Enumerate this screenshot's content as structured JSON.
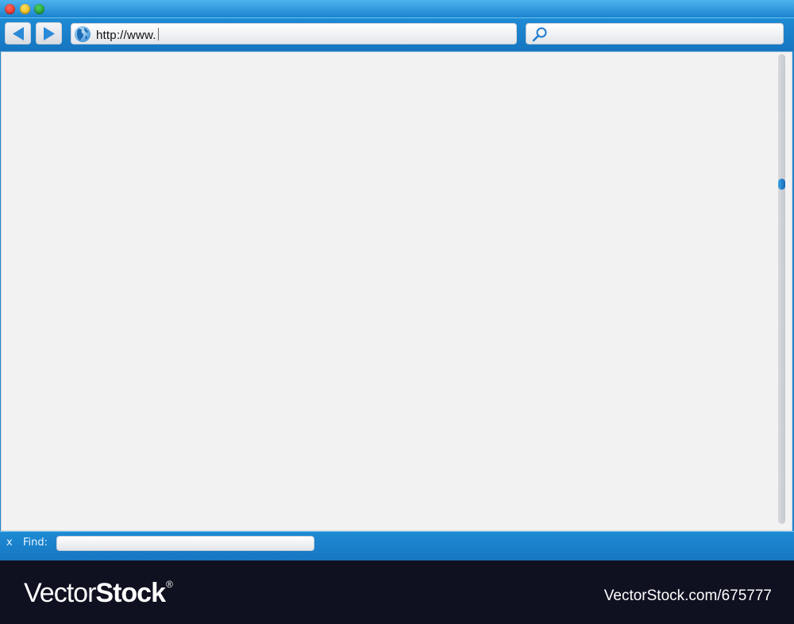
{
  "window": {
    "controls": {
      "close": "close-icon",
      "minimize": "minimize-icon",
      "maximize": "maximize-icon"
    },
    "accent_color": "#1f86cf"
  },
  "toolbar": {
    "back_icon": "back-arrow-icon",
    "forward_icon": "forward-arrow-icon",
    "url": {
      "icon": "globe-icon",
      "value": "http://www."
    },
    "search": {
      "icon": "search-icon",
      "value": ""
    }
  },
  "find_bar": {
    "close_label": "x",
    "label": "Find:",
    "value": ""
  },
  "watermark": {
    "brand_light": "Vector",
    "brand_bold": "Stock",
    "registered": "®",
    "url": "VectorStock.com/675777"
  }
}
